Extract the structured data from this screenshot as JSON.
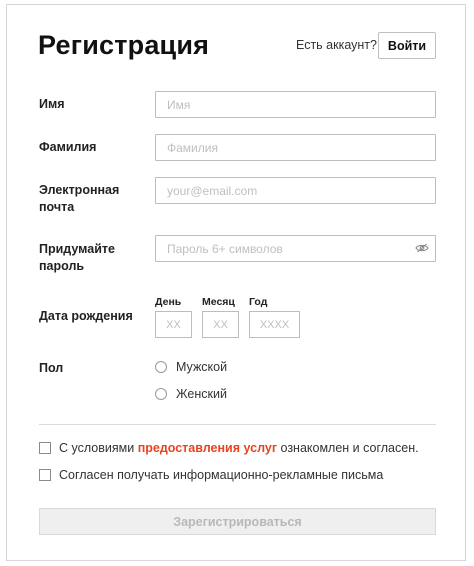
{
  "header": {
    "title": "Регистрация",
    "have_account": "Есть аккаунт?",
    "login_label": "Войти"
  },
  "form": {
    "first_name": {
      "label": "Имя",
      "placeholder": "Имя",
      "value": ""
    },
    "last_name": {
      "label": "Фамилия",
      "placeholder": "Фамилия",
      "value": ""
    },
    "email": {
      "label_line1": "Электронная",
      "label_line2": "почта",
      "placeholder": "your@email.com",
      "value": ""
    },
    "password": {
      "label_line1": "Придумайте",
      "label_line2": "пароль",
      "placeholder": "Пароль 6+ символов",
      "value": "",
      "toggle_icon": "eye-off-icon"
    },
    "birth_date": {
      "label": "Дата рождения",
      "day": {
        "header": "День",
        "placeholder": "XX"
      },
      "month": {
        "header": "Месяц",
        "placeholder": "XX"
      },
      "year": {
        "header": "Год",
        "placeholder": "XXXX"
      }
    },
    "gender": {
      "label": "Пол",
      "options": [
        {
          "label": "Мужской",
          "checked": false
        },
        {
          "label": "Женский",
          "checked": false
        }
      ]
    }
  },
  "agreements": {
    "terms_prefix": "С условиями ",
    "terms_link": "предоставления услуг",
    "terms_suffix": " ознакомлен и согласен.",
    "newsletter": "Согласен получать информационно-рекламные письма"
  },
  "submit_label": "Зарегистрироваться",
  "colors": {
    "accent_link": "#e8441f",
    "border": "#bdbdbd",
    "disabled_bg": "#efefef",
    "disabled_text": "#b8b8b8"
  }
}
